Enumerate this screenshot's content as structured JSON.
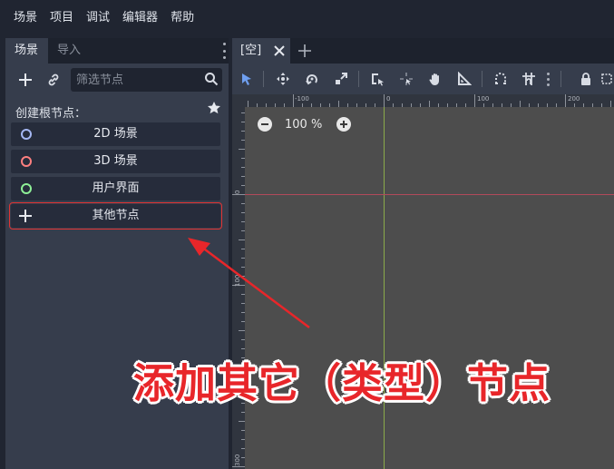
{
  "menubar": {
    "items": [
      "场景",
      "项目",
      "调试",
      "编辑器",
      "帮助"
    ]
  },
  "scene_dock": {
    "tabs": [
      "场景",
      "导入"
    ],
    "filter_placeholder": "筛选节点",
    "create_root_label": "创建根节点：",
    "root_buttons": [
      {
        "label": "2D 场景",
        "icon": "2d-node-ring-icon",
        "color": "#a5b7f3"
      },
      {
        "label": "3D 场景",
        "icon": "3d-node-ring-icon",
        "color": "#fc7f7f"
      },
      {
        "label": "用户界面",
        "icon": "control-node-ring-icon",
        "color": "#8eef97"
      },
      {
        "label": "其他节点",
        "icon": "plus-icon",
        "color": "#e0e4ec"
      }
    ]
  },
  "editor": {
    "tab_name": "[空]",
    "zoom_label": "100 %",
    "ruler_h": [
      "-100",
      "0",
      "100",
      "200"
    ],
    "ruler_v": [
      "0",
      "100",
      "300"
    ],
    "colors": {
      "axis_x": "#b24a5a",
      "axis_y": "#8bab4a",
      "select_tool": "#6f9ff0"
    }
  },
  "annotation": {
    "text": "添加其它（类型）节点",
    "color": "#e8262a"
  }
}
